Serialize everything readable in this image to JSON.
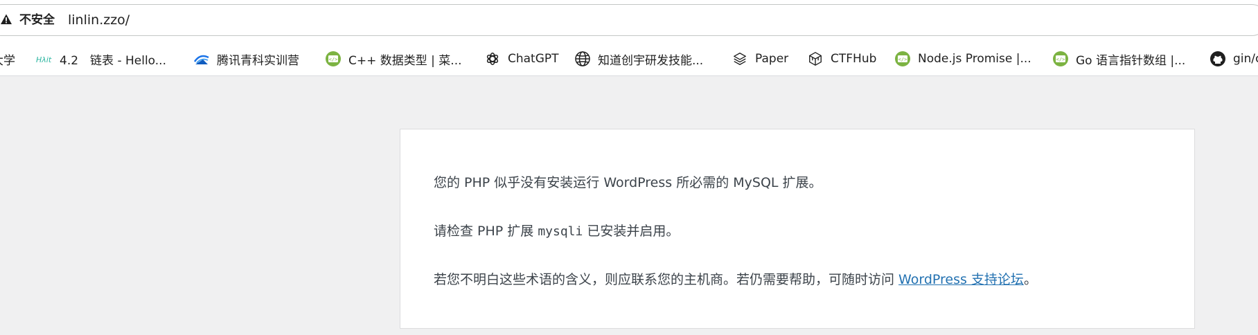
{
  "address_bar": {
    "security_label": "不安全",
    "url": "linlin.zzo/"
  },
  "bookmarks": [
    {
      "label": "大学",
      "icon": "none"
    },
    {
      "label": "4.2　链表 - Hello...",
      "icon": "hello-algo-icon"
    },
    {
      "label": "腾讯青科实训营",
      "icon": "tencent-icon"
    },
    {
      "label": "C++ 数据类型 | 菜...",
      "icon": "runoob-icon"
    },
    {
      "label": "ChatGPT",
      "icon": "openai-icon"
    },
    {
      "label": "知道创宇研发技能...",
      "icon": "globe-icon"
    },
    {
      "label": "Paper",
      "icon": "layers-icon"
    },
    {
      "label": "CTFHub",
      "icon": "cube-icon"
    },
    {
      "label": "Node.js Promise |...",
      "icon": "runoob-icon"
    },
    {
      "label": "Go 语言指针数组 |...",
      "icon": "runoob-icon"
    },
    {
      "label": "gin/c",
      "icon": "github-icon"
    }
  ],
  "content": {
    "line1": "您的 PHP 似乎没有安装运行 WordPress 所必需的 MySQL 扩展。",
    "line2_before": "请检查 PHP 扩展 ",
    "line2_code": "mysqli",
    "line2_after": " 已安装并启用。",
    "line3_before": "若您不明白这些术语的含义，则应联系您的主机商。若仍需要帮助，可随时访问 ",
    "line3_link": "WordPress 支持论坛",
    "line3_after": "。"
  },
  "colors": {
    "page_bg": "#f0f0f1",
    "text": "#3c434a",
    "link": "#2271b1",
    "runoob_green": "#7cb342"
  }
}
